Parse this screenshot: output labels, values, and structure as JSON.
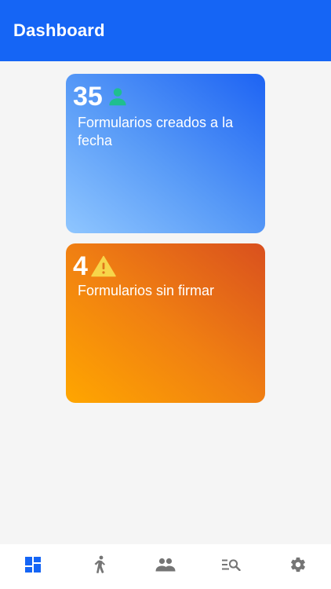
{
  "header": {
    "title": "Dashboard"
  },
  "cards": [
    {
      "count": "35",
      "label": "Formularios creados a la fecha",
      "icon": "person-icon"
    },
    {
      "count": "4",
      "label": "Formularios sin firmar",
      "icon": "warning-icon"
    }
  ],
  "bottom_nav": {
    "items": [
      {
        "icon": "dashboard-icon",
        "active": true
      },
      {
        "icon": "walking-person-icon",
        "active": false
      },
      {
        "icon": "people-icon",
        "active": false
      },
      {
        "icon": "list-search-icon",
        "active": false
      },
      {
        "icon": "settings-icon",
        "active": false
      }
    ]
  },
  "colors": {
    "primary": "#1565f5",
    "person_icon": "#1fbf8f",
    "warning_icon": "#f7d54a",
    "nav_inactive": "#757575"
  }
}
